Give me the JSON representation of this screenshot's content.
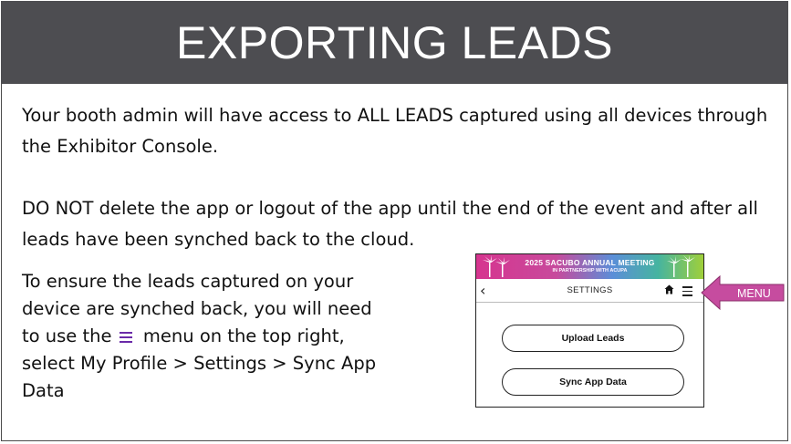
{
  "slide": {
    "title": "EXPORTING LEADS",
    "paragraph1": "Your booth admin will have access to ALL LEADS captured using all devices through the Exhibitor Console.",
    "paragraph2": "DO NOT delete the app or logout of the app until the end of the event and after all leads have been synched back to the cloud.",
    "paragraph3_part1": "To ensure the leads captured on your device are synched back, you will need to use the",
    "paragraph3_part2": "menu on the top right, select My Profile > Settings > Sync App Data"
  },
  "app_screenshot": {
    "banner_title": "2025 SACUBO ANNUAL MEETING",
    "banner_subtitle": "IN PARTNERSHIP WITH ACUPA",
    "nav_title": "SETTINGS",
    "upload_button": "Upload Leads",
    "sync_button": "Sync App Data"
  },
  "callout": {
    "label": "MENU",
    "color": "#c64c9f"
  },
  "colors": {
    "title_bar": "#4d4d51",
    "menu_icon": "#6a2aa8"
  },
  "icons": [
    "menu-icon",
    "back-chevron-icon",
    "home-icon",
    "hamburger-icon",
    "palm-tree-icon",
    "arrow-callout"
  ]
}
